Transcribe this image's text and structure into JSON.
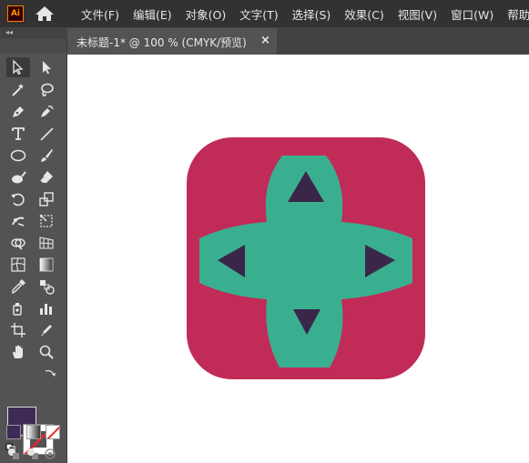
{
  "app": {
    "logo_text": "Ai"
  },
  "menu": {
    "items": [
      "文件(F)",
      "编辑(E)",
      "对象(O)",
      "文字(T)",
      "选择(S)",
      "效果(C)",
      "视图(V)",
      "窗口(W)",
      "帮助(H)"
    ]
  },
  "document": {
    "tab_title": "未标题-1* @ 100 % (CMYK/预览)",
    "close_glyph": "×"
  },
  "panel": {
    "collapse_glyph": "◂◂"
  },
  "tools": [
    "selection-tool",
    "direct-selection-tool",
    "magic-wand-tool",
    "lasso-tool",
    "pen-tool",
    "curvature-tool",
    "type-tool",
    "line-segment-tool",
    "ellipse-tool",
    "paintbrush-tool",
    "blob-brush-tool",
    "eraser-tool",
    "rotate-tool",
    "scale-tool",
    "puppet-warp-tool",
    "free-transform-tool",
    "shape-builder-tool",
    "perspective-grid-tool",
    "mesh-tool",
    "gradient-tool",
    "eyedropper-tool",
    "blend-tool",
    "symbol-sprayer-tool",
    "column-graph-tool",
    "artboard-tool",
    "slice-tool",
    "hand-tool",
    "zoom-tool"
  ],
  "colors": {
    "fill": "#3d2a55",
    "icon_background": "#c12b57",
    "cross": "#3aaf90",
    "arrows": "#3a2649"
  }
}
